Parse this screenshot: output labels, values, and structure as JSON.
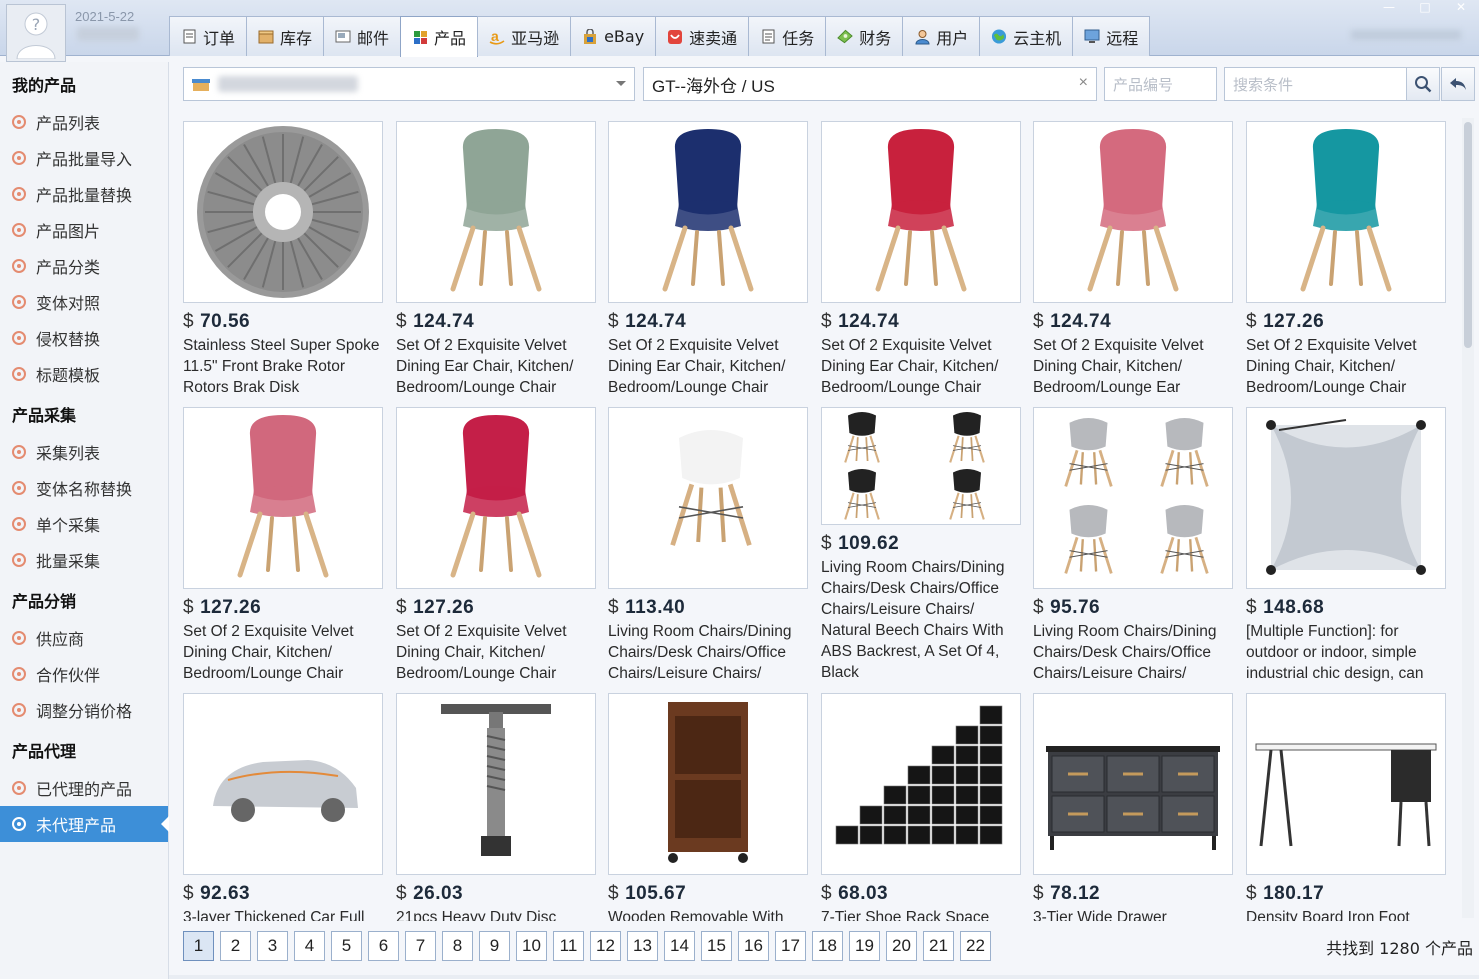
{
  "header": {
    "date": "2021-5-22",
    "tabs": [
      {
        "label": "订单",
        "icon": "order-icon"
      },
      {
        "label": "库存",
        "icon": "inventory-icon"
      },
      {
        "label": "邮件",
        "icon": "mail-icon"
      },
      {
        "label": "产品",
        "icon": "product-icon",
        "active": true
      },
      {
        "label": "亚马逊",
        "icon": "amazon-icon"
      },
      {
        "label": "eBay",
        "icon": "ebay-icon"
      },
      {
        "label": "速卖通",
        "icon": "aliexpress-icon"
      },
      {
        "label": "任务",
        "icon": "task-icon"
      },
      {
        "label": "财务",
        "icon": "finance-icon"
      },
      {
        "label": "用户",
        "icon": "user-icon"
      },
      {
        "label": "云主机",
        "icon": "cloud-host-icon"
      },
      {
        "label": "远程",
        "icon": "remote-icon"
      }
    ]
  },
  "sidebar": {
    "groups": [
      {
        "title": "我的产品",
        "items": [
          "产品列表",
          "产品批量导入",
          "产品批量替换",
          "产品图片",
          "产品分类",
          "变体对照",
          "侵权替换",
          "标题模板"
        ]
      },
      {
        "title": "产品采集",
        "items": [
          "采集列表",
          "变体名称替换",
          "单个采集",
          "批量采集"
        ]
      },
      {
        "title": "产品分销",
        "items": [
          "供应商",
          "合作伙伴",
          "调整分销价格"
        ]
      },
      {
        "title": "产品代理",
        "items": [
          "已代理的产品",
          "未代理产品"
        ]
      }
    ],
    "active_item": "未代理产品"
  },
  "filters": {
    "warehouse": "GT--海外仓 / US",
    "product_code_placeholder": "产品编号",
    "search_placeholder": "搜索条件"
  },
  "products": [
    {
      "currency": "$",
      "price": "70.56",
      "title": "Stainless Steel Super Spoke 11.5\" Front Brake Rotor Rotors Brak Disk",
      "image": "brake-rotor"
    },
    {
      "currency": "$",
      "price": "124.74",
      "title": "Set Of 2 Exquisite Velvet Dining Ear Chair, Kitchen/ Bedroom/Lounge Chair",
      "image": "chair",
      "color": "#8fa596"
    },
    {
      "currency": "$",
      "price": "124.74",
      "title": "Set Of 2 Exquisite Velvet Dining Ear Chair, Kitchen/ Bedroom/Lounge Chair",
      "image": "chair",
      "color": "#1c2f6e"
    },
    {
      "currency": "$",
      "price": "124.74",
      "title": "Set Of 2 Exquisite Velvet Dining Ear Chair, Kitchen/ Bedroom/Lounge Chair",
      "image": "chair",
      "color": "#c8213d"
    },
    {
      "currency": "$",
      "price": "124.74",
      "title": "Set Of 2 Exquisite Velvet Dining Chair, Kitchen/ Bedroom/Lounge Ear",
      "image": "chair",
      "color": "#d46a7e"
    },
    {
      "currency": "$",
      "price": "127.26",
      "title": "Set Of 2 Exquisite Velvet Dining Chair, Kitchen/ Bedroom/Lounge Chair",
      "image": "chair",
      "color": "#1597a1"
    },
    {
      "currency": "$",
      "price": "127.26",
      "title": "Set Of 2 Exquisite Velvet Dining Chair, Kitchen/ Bedroom/Lounge Chair",
      "image": "chair",
      "color": "#d1687d"
    },
    {
      "currency": "$",
      "price": "127.26",
      "title": "Set Of 2 Exquisite Velvet Dining Chair, Kitchen/ Bedroom/Lounge Chair",
      "image": "chair",
      "color": "#c41f48"
    },
    {
      "currency": "$",
      "price": "113.40",
      "title": "Living Room Chairs/Dining Chairs/Desk Chairs/Office Chairs/Leisure Chairs/",
      "image": "eames-white"
    },
    {
      "currency": "$",
      "price": "109.62",
      "title": "Living Room Chairs/Dining Chairs/Desk Chairs/Office Chairs/Leisure Chairs/ Natural Beech Chairs With ABS Backrest, A Set Of 4, Black",
      "image": "eames-black-set"
    },
    {
      "currency": "$",
      "price": "95.76",
      "title": "Living Room Chairs/Dining Chairs/Desk Chairs/Office Chairs/Leisure Chairs/",
      "image": "eames-grey-set"
    },
    {
      "currency": "$",
      "price": "148.68",
      "title": "[Multiple Function]: for outdoor or indoor, simple industrial chic design, can",
      "image": "hammock-seat"
    },
    {
      "currency": "$",
      "price": "92.63",
      "title": "3-layer Thickened Car Full",
      "image": "car-cover"
    },
    {
      "currency": "$",
      "price": "26.03",
      "title": "21pcs Heavy Duty Disc",
      "image": "brake-tool"
    },
    {
      "currency": "$",
      "price": "105.67",
      "title": "Wooden Removable With",
      "image": "wood-cabinet"
    },
    {
      "currency": "$",
      "price": "68.03",
      "title": "7-Tier Shoe Rack Space",
      "image": "shoe-rack"
    },
    {
      "currency": "$",
      "price": "78.12",
      "title": "3-Tier Wide Drawer",
      "image": "drawer"
    },
    {
      "currency": "$",
      "price": "180.17",
      "title": "Density Board Iron Foot",
      "image": "desk"
    }
  ],
  "pagination": {
    "pages": [
      "1",
      "2",
      "3",
      "4",
      "5",
      "6",
      "7",
      "8",
      "9",
      "10",
      "11",
      "12",
      "13",
      "14",
      "15",
      "16",
      "17",
      "18",
      "19",
      "20",
      "21",
      "22"
    ],
    "current": "1",
    "total_text": "共找到 1280 个产品"
  }
}
